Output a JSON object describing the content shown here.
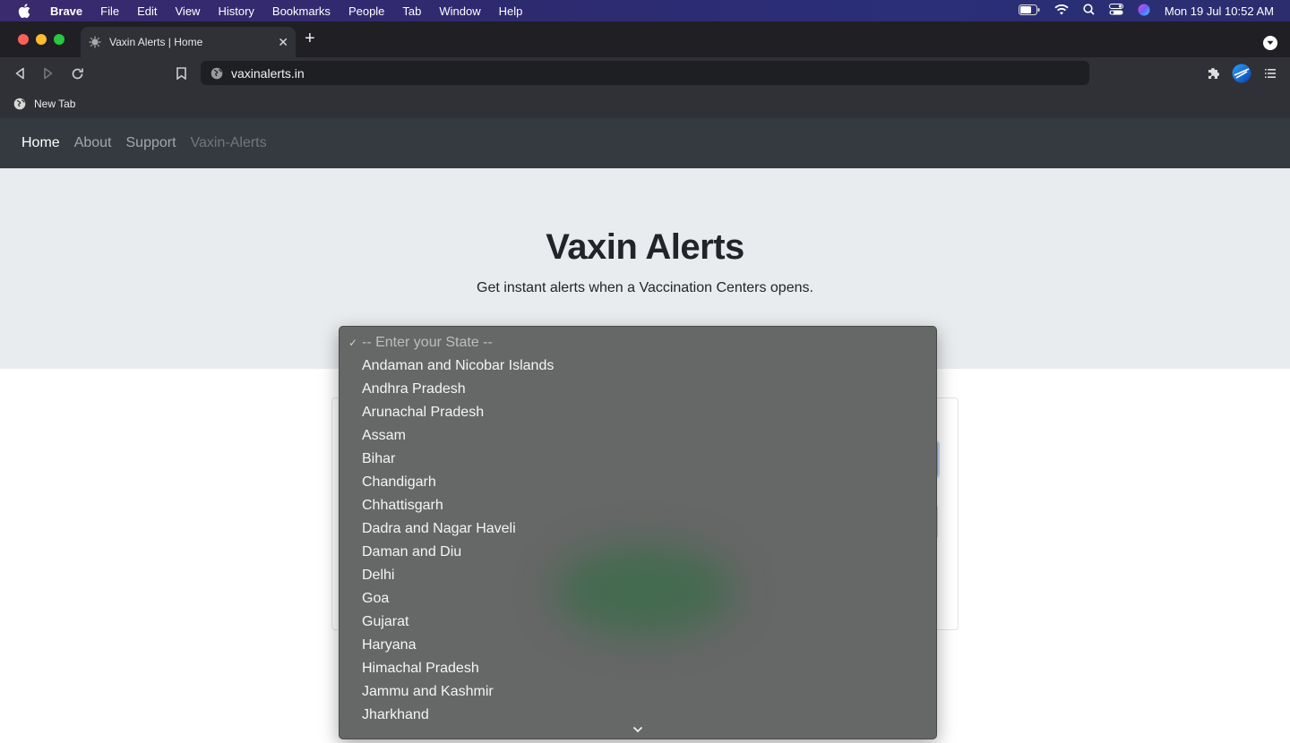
{
  "menubar": {
    "app_name": "Brave",
    "items": [
      "File",
      "Edit",
      "View",
      "History",
      "Bookmarks",
      "People",
      "Tab",
      "Window",
      "Help"
    ],
    "clock": "Mon 19 Jul  10:52 AM"
  },
  "browser": {
    "tab_title": "Vaxin Alerts | Home",
    "tab_close": "✕",
    "new_tab": "+",
    "url": "vaxinalerts.in",
    "bookmark_label": "New Tab"
  },
  "site_nav": {
    "home": "Home",
    "about": "About",
    "support": "Support",
    "brand": "Vaxin-Alerts"
  },
  "hero": {
    "title": "Vaxin Alerts",
    "subtitle": "Get instant alerts when a Vaccination Centers opens."
  },
  "dropdown": {
    "placeholder": "-- Enter your State --",
    "check": "✓",
    "options": [
      "Andaman and Nicobar Islands",
      "Andhra Pradesh",
      "Arunachal Pradesh",
      "Assam",
      "Bihar",
      "Chandigarh",
      "Chhattisgarh",
      "Dadra and Nagar Haveli",
      "Daman and Diu",
      "Delhi",
      "Goa",
      "Gujarat",
      "Haryana",
      "Himachal Pradesh",
      "Jammu and Kashmir",
      "Jharkhand"
    ]
  },
  "colors": {
    "site_nav_bg": "#343a40",
    "hero_bg": "#e9ecef",
    "dropdown_bg": "#666767"
  }
}
